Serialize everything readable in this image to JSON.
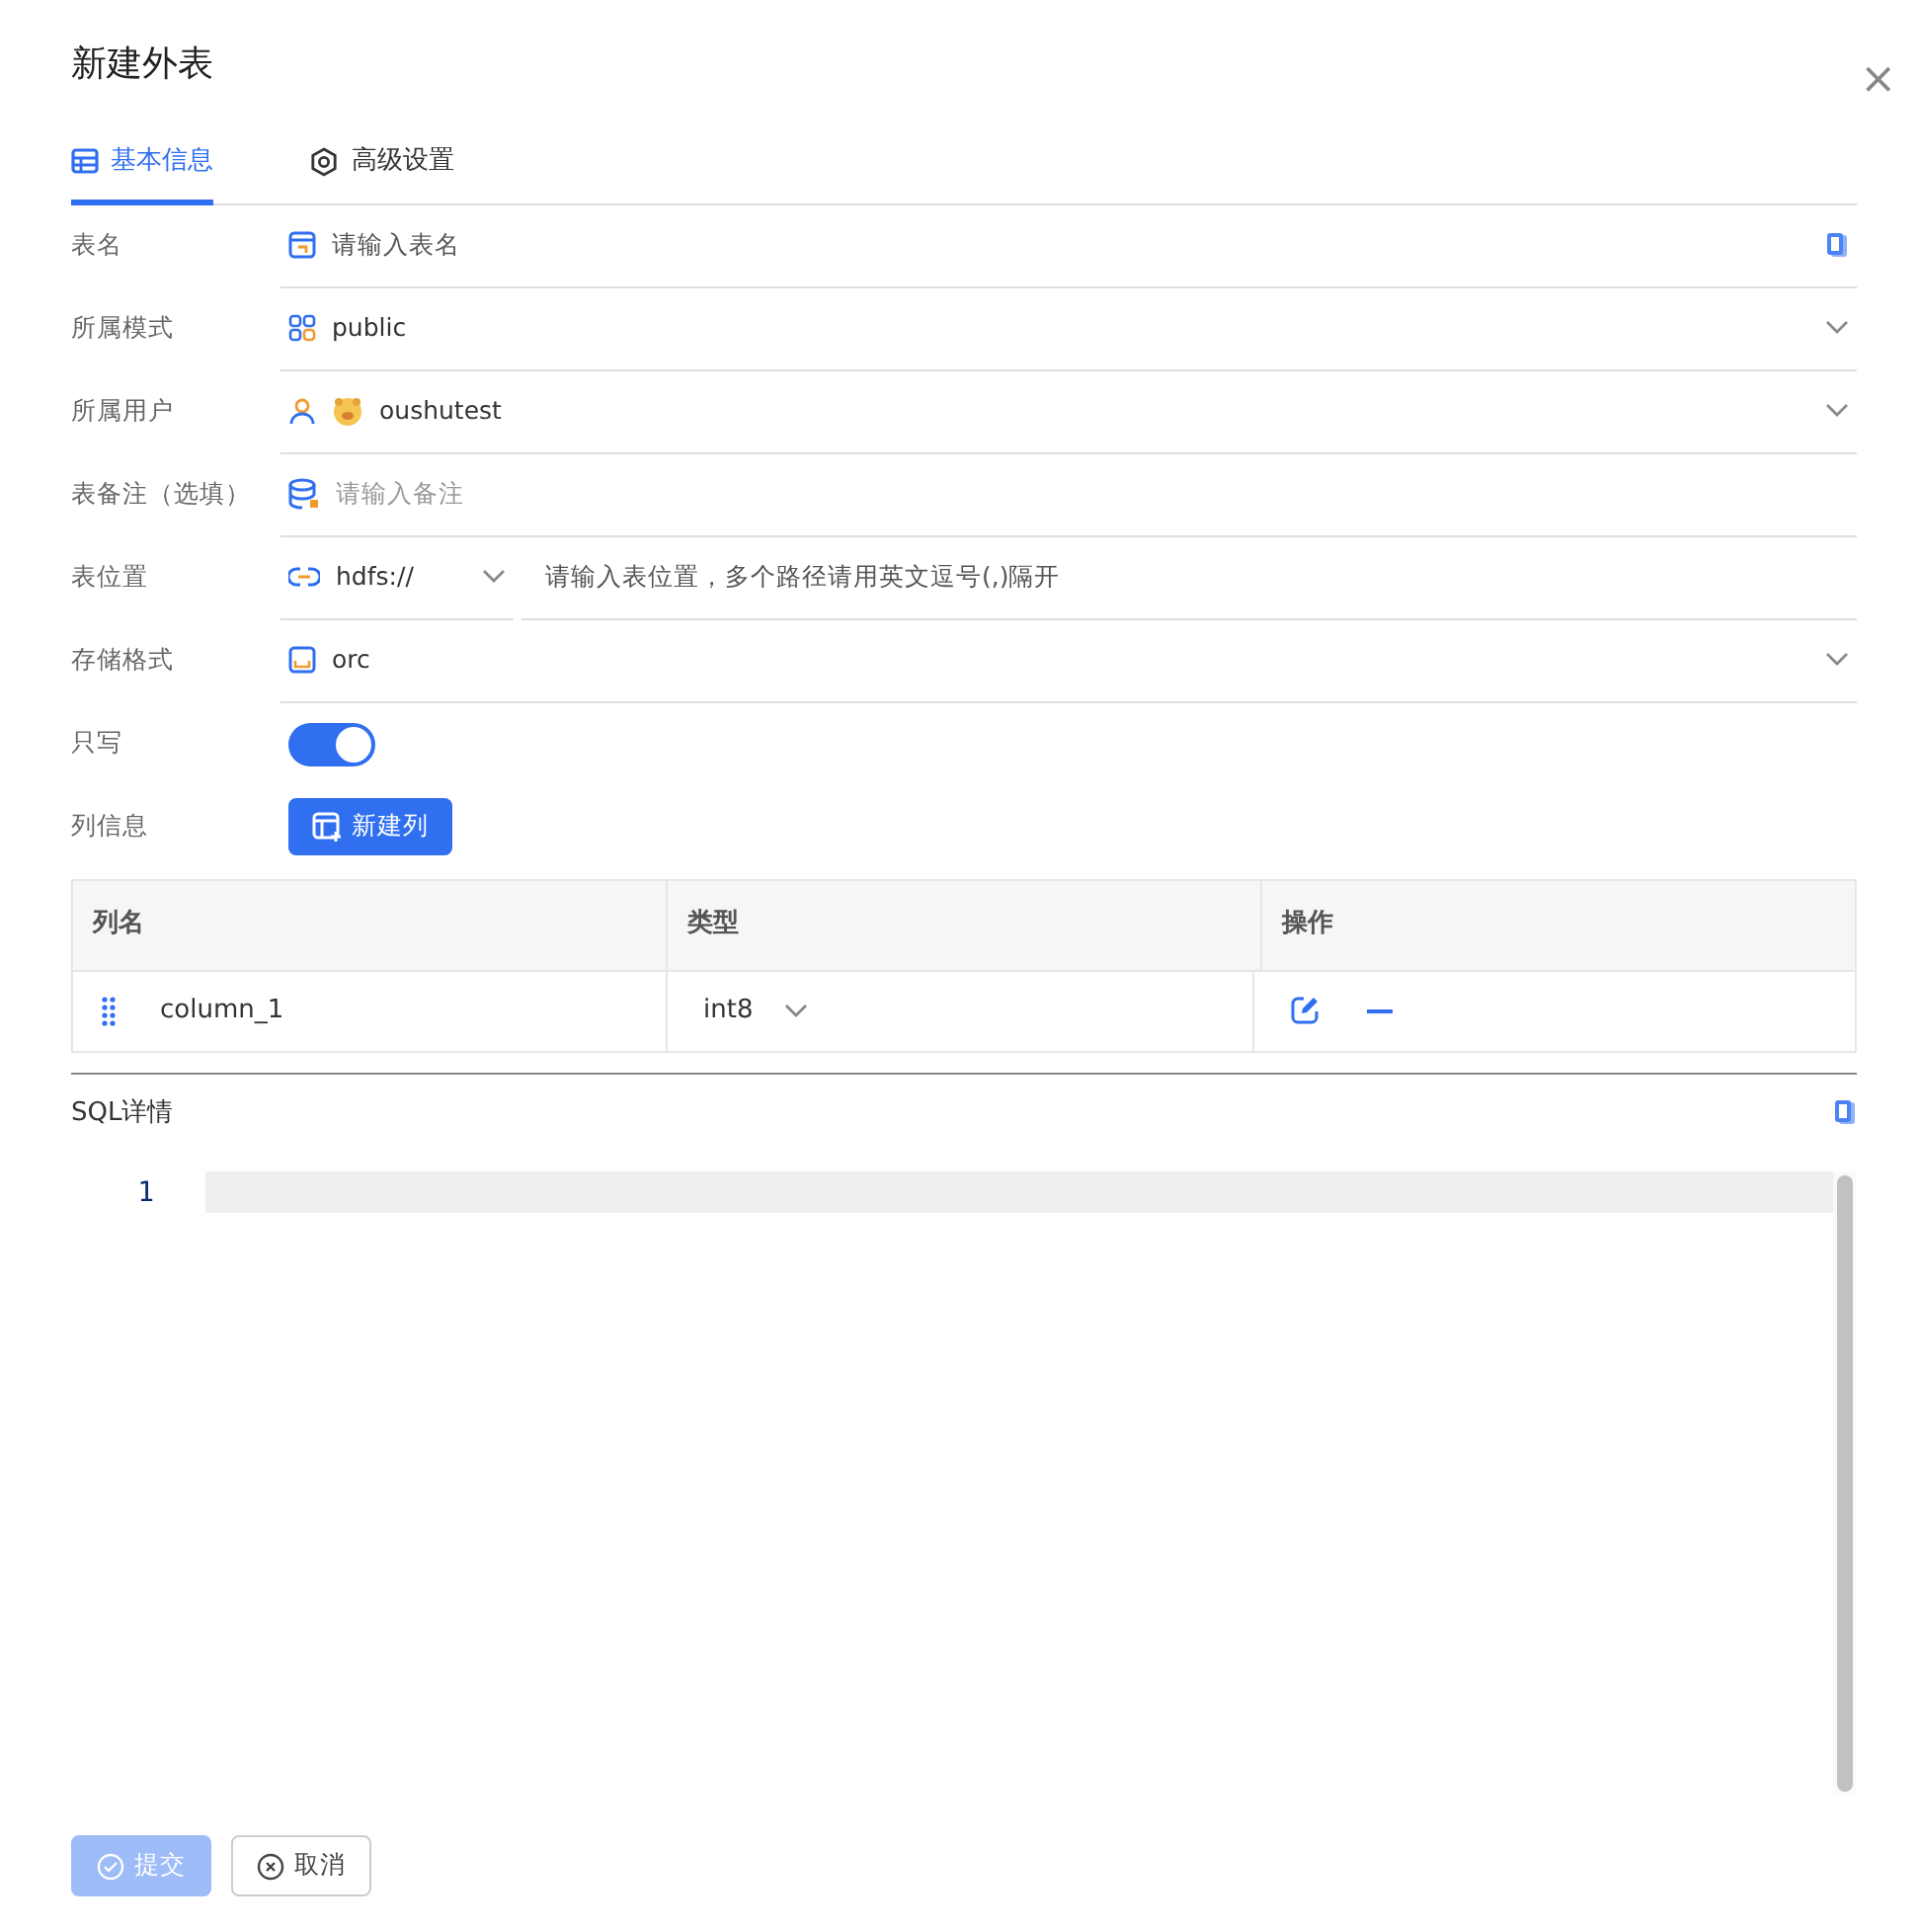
{
  "dialog": {
    "title": "新建外表",
    "close": "×"
  },
  "tabs": [
    {
      "label": "基本信息",
      "selected": true
    },
    {
      "label": "高级设置",
      "selected": false
    }
  ],
  "fields": [
    {
      "label": "表名",
      "kind": "input",
      "placeholder": "请输入表名",
      "copy": true
    },
    {
      "label": "所属模式",
      "kind": "select",
      "value": "public"
    },
    {
      "label": "所属用户",
      "kind": "user",
      "value": "oushutest"
    },
    {
      "label": "表备注（选填）",
      "kind": "input",
      "placeholder": "请输入备注",
      "copy": false
    },
    {
      "label": "表位置",
      "kind": "location",
      "prefix": "hdfs://",
      "placeholder": "请输入表位置，多个路径请用英文逗号(,)隔开"
    },
    {
      "label": "存储格式",
      "kind": "select",
      "value": "orc"
    },
    {
      "label": "只写",
      "kind": "switch",
      "on": true
    },
    {
      "label": "列信息",
      "kind": "button",
      "button": "新建列"
    }
  ],
  "table": {
    "columns": [
      "列名",
      "类型",
      "操作"
    ],
    "rows": [
      {
        "name": "column_1",
        "type": "int8"
      }
    ]
  },
  "sql": {
    "title": "SQL详情",
    "line_numbers": [
      "1"
    ]
  },
  "footer": [
    {
      "label": "提交",
      "kind": "submit",
      "disabled": true
    },
    {
      "label": "取消",
      "kind": "cancel",
      "disabled": false
    }
  ]
}
